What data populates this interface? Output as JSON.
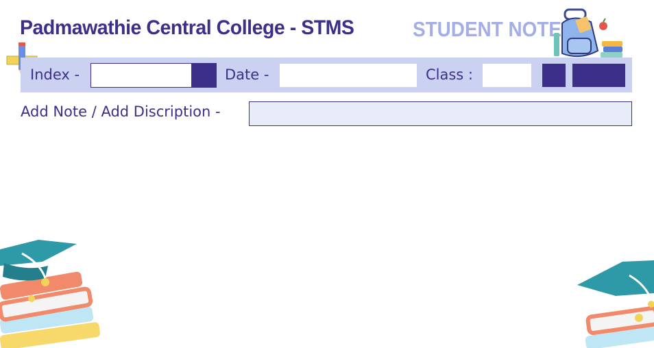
{
  "header": {
    "app_title": "Padmawathie Central College - STMS",
    "module_title": "STUDENT NOTE"
  },
  "toolbar": {
    "index_label": "Index -",
    "index_value": "",
    "date_label": "Date -",
    "date_value": "",
    "class_label": "Class :",
    "class_value": ""
  },
  "note": {
    "label": "Add Note / Add Discription -",
    "value": ""
  },
  "colors": {
    "primary": "#3b2f8a",
    "toolbar_bg": "#cbd1f0",
    "module_title": "#a5aee4",
    "note_field_bg": "#e8ebf8"
  },
  "icons": [
    "backpack-icon",
    "pencil-ruler-icon",
    "graduation-books-icon"
  ]
}
